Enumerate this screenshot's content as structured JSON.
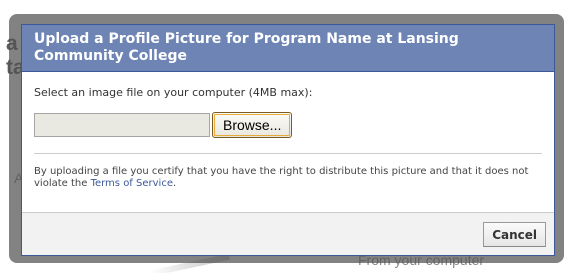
{
  "background": {
    "fragments": [
      "a",
      "ta",
      "A",
      "From your computer"
    ]
  },
  "dialog": {
    "title": "Upload a Profile Picture for Program Name at Lansing Community College",
    "file_label": "Select an image file on your computer (4MB max):",
    "file_path_value": "",
    "browse_label": "Browse...",
    "terms_text_prefix": "By uploading a file you certify that you have the right to distribute this picture and that it does not violate the ",
    "terms_link": "Terms of Service",
    "terms_text_suffix": ".",
    "cancel_label": "Cancel"
  },
  "colors": {
    "header_bg": "#6d84b4",
    "header_border": "#3b5998",
    "link": "#3b5998",
    "overlay": "#525252"
  }
}
